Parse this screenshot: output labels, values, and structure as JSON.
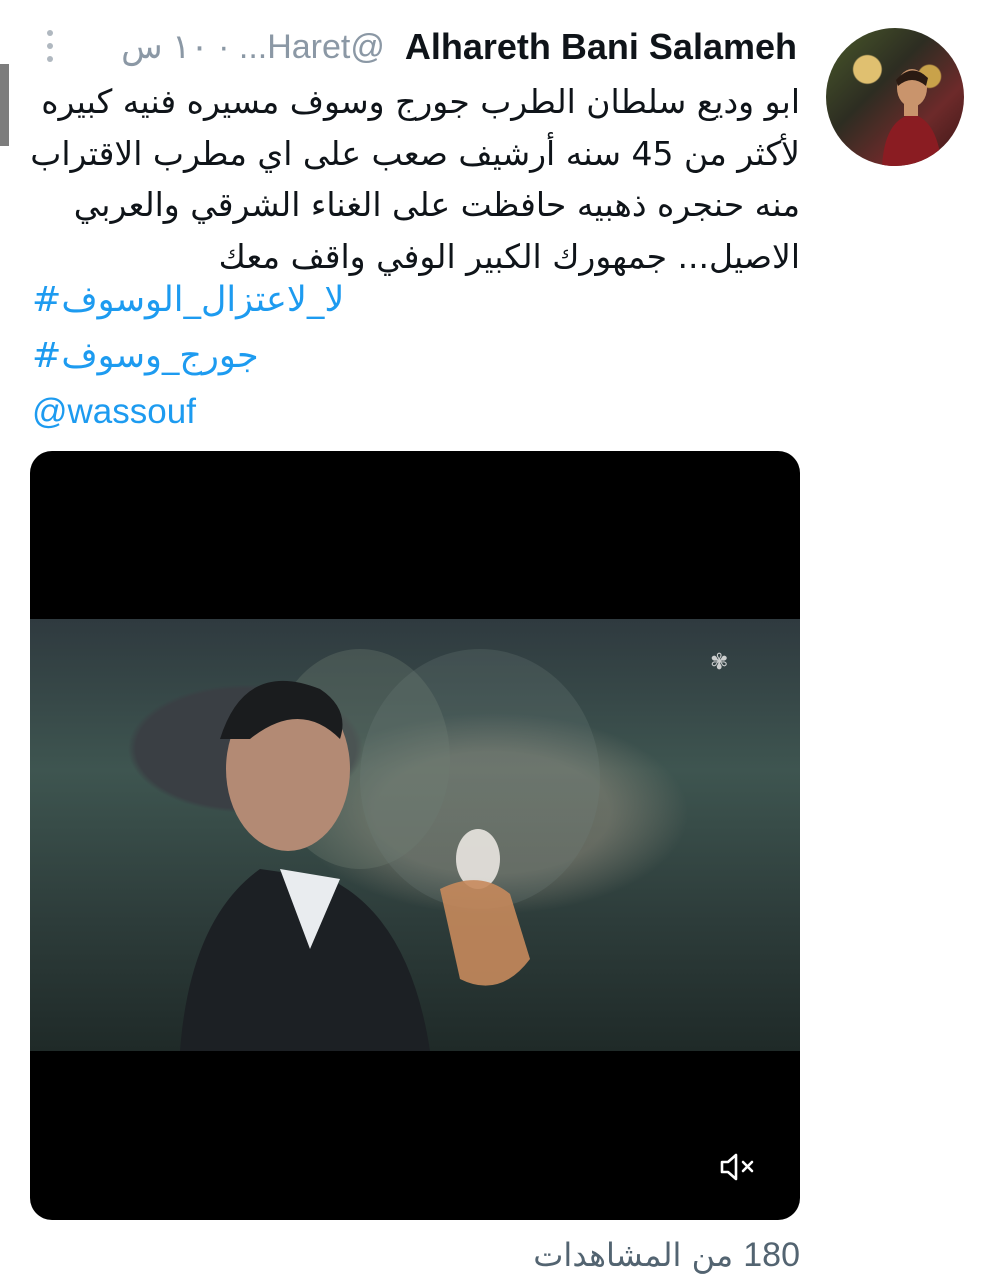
{
  "tweet": {
    "author_name": "Alhareth Bani Salameh",
    "handle": "@Haret...",
    "time": "١٠ س",
    "separator": "·",
    "text": "ابو وديع سلطان الطرب جورج وسوف مسيره فنيه كبيره لأكثر من 45 سنه أرشيف صعب على اي مطرب الاقتراب منه حنجره ذهبيه حافظت على الغناء الشرقي والعربي الاصيل... جمهورك الكبير الوفي واقف معك",
    "hashtags": [
      "#لا_لاعتزال_الوسوف",
      "#جورج_وسوف"
    ],
    "mention": "@wassouf",
    "views_count": "180",
    "views_label": "من المشاهدات"
  },
  "icons": {
    "more": "more-vertical-icon",
    "mute": "volume-muted-icon"
  },
  "colors": {
    "link": "#1d9bf0",
    "secondary_text": "#536471",
    "media_bg": "#000000"
  }
}
